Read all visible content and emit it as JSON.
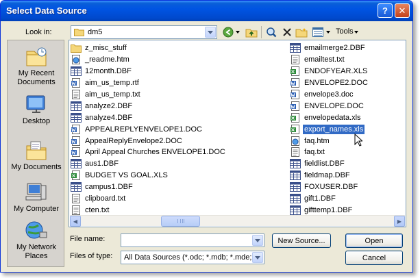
{
  "window": {
    "title": "Select Data Source"
  },
  "titlebar": {
    "help_label": "?",
    "close_label": "✕"
  },
  "toolbar": {
    "look_in_label": "Look in:",
    "look_in_value": "dm5",
    "tools_label": "Tools",
    "icons": [
      "back-icon",
      "up-folder-icon",
      "search-web-icon",
      "delete-icon",
      "new-folder-icon",
      "views-icon"
    ]
  },
  "places": [
    {
      "label": "My Recent Documents",
      "icon": "recent-documents-icon"
    },
    {
      "label": "Desktop",
      "icon": "desktop-icon"
    },
    {
      "label": "My Documents",
      "icon": "my-documents-icon"
    },
    {
      "label": "My Computer",
      "icon": "my-computer-icon"
    },
    {
      "label": "My Network Places",
      "icon": "network-places-icon"
    }
  ],
  "files": {
    "column1": [
      {
        "name": "z_misc_stuff",
        "type": "folder"
      },
      {
        "name": "_readme.htm",
        "type": "htm"
      },
      {
        "name": "12month.DBF",
        "type": "dbf"
      },
      {
        "name": "aim_us_temp.rtf",
        "type": "doc"
      },
      {
        "name": "aim_us_temp.txt",
        "type": "txt"
      },
      {
        "name": "analyze2.DBF",
        "type": "dbf"
      },
      {
        "name": "analyze4.DBF",
        "type": "dbf"
      },
      {
        "name": "APPEALREPLYENVELOPE1.DOC",
        "type": "doc"
      },
      {
        "name": "AppealReplyEnvelope2.DOC",
        "type": "doc"
      },
      {
        "name": "April Appeal Churches ENVELOPE1.DOC",
        "type": "doc"
      },
      {
        "name": "aus1.DBF",
        "type": "dbf"
      },
      {
        "name": "BUDGET VS GOAL.XLS",
        "type": "xls"
      },
      {
        "name": "campus1.DBF",
        "type": "dbf"
      },
      {
        "name": "clipboard.txt",
        "type": "txt"
      },
      {
        "name": "cten.txt",
        "type": "txt"
      }
    ],
    "column2": [
      {
        "name": "emailmerge2.DBF",
        "type": "dbf"
      },
      {
        "name": "emailtest.txt",
        "type": "txt"
      },
      {
        "name": "ENDOFYEAR.XLS",
        "type": "xls"
      },
      {
        "name": "ENVELOPE2.DOC",
        "type": "doc"
      },
      {
        "name": "envelope3.doc",
        "type": "doc"
      },
      {
        "name": "ENVELOPE.DOC",
        "type": "doc"
      },
      {
        "name": "envelopedata.xls",
        "type": "xls"
      },
      {
        "name": "export_names.xls",
        "type": "xls",
        "selected": true
      },
      {
        "name": "faq.htm",
        "type": "htm"
      },
      {
        "name": "faq.txt",
        "type": "txt"
      },
      {
        "name": "fieldlist.DBF",
        "type": "dbf"
      },
      {
        "name": "fieldmap.DBF",
        "type": "dbf"
      },
      {
        "name": "FOXUSER.DBF",
        "type": "dbf"
      },
      {
        "name": "gift1.DBF",
        "type": "dbf"
      },
      {
        "name": "gifttemp1.DBF",
        "type": "dbf"
      }
    ]
  },
  "form": {
    "file_name_label": "File name:",
    "file_name_value": "",
    "files_of_type_label": "Files of type:",
    "files_of_type_value": "All Data Sources (*.odc; *.mdb; *.mde;"
  },
  "buttons": {
    "new_source": "New Source...",
    "open": "Open",
    "cancel": "Cancel"
  }
}
